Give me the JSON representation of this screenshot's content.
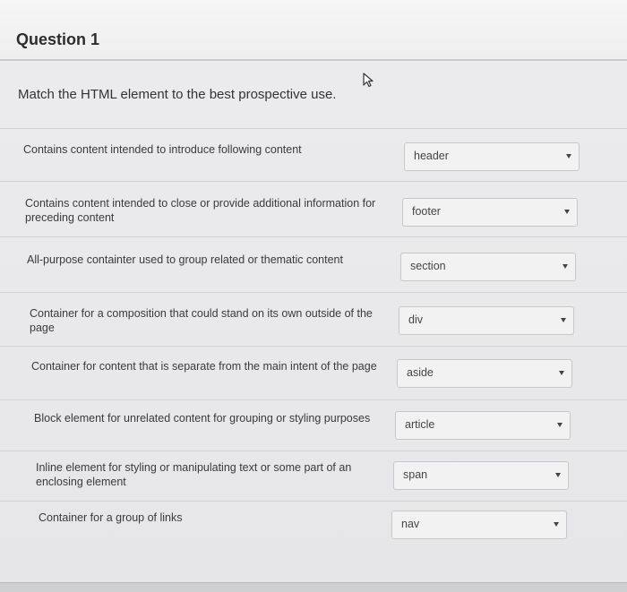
{
  "question": {
    "title": "Question 1",
    "prompt": "Match the HTML element to the best prospective use."
  },
  "matches": [
    {
      "label": "Contains content intended to introduce following content",
      "selected": "header"
    },
    {
      "label": "Contains content intended to close or provide additional information for preceding content",
      "selected": "footer"
    },
    {
      "label": "All-purpose containter used to group related or thematic content",
      "selected": "section"
    },
    {
      "label": "Container for a composition that could stand on its own outside of the page",
      "selected": "div"
    },
    {
      "label": "Container for content that is separate from the main intent of the page",
      "selected": "aside"
    },
    {
      "label": "Block element for unrelated content for grouping or styling purposes",
      "selected": "article"
    },
    {
      "label": "Inline element for styling or manipulating text or some part of an enclosing element",
      "selected": "span"
    },
    {
      "label": "Container for a group of links",
      "selected": "nav"
    }
  ],
  "icons": {
    "cursor": "mouse-pointer-icon",
    "dropdown": "chevron-down-icon"
  }
}
